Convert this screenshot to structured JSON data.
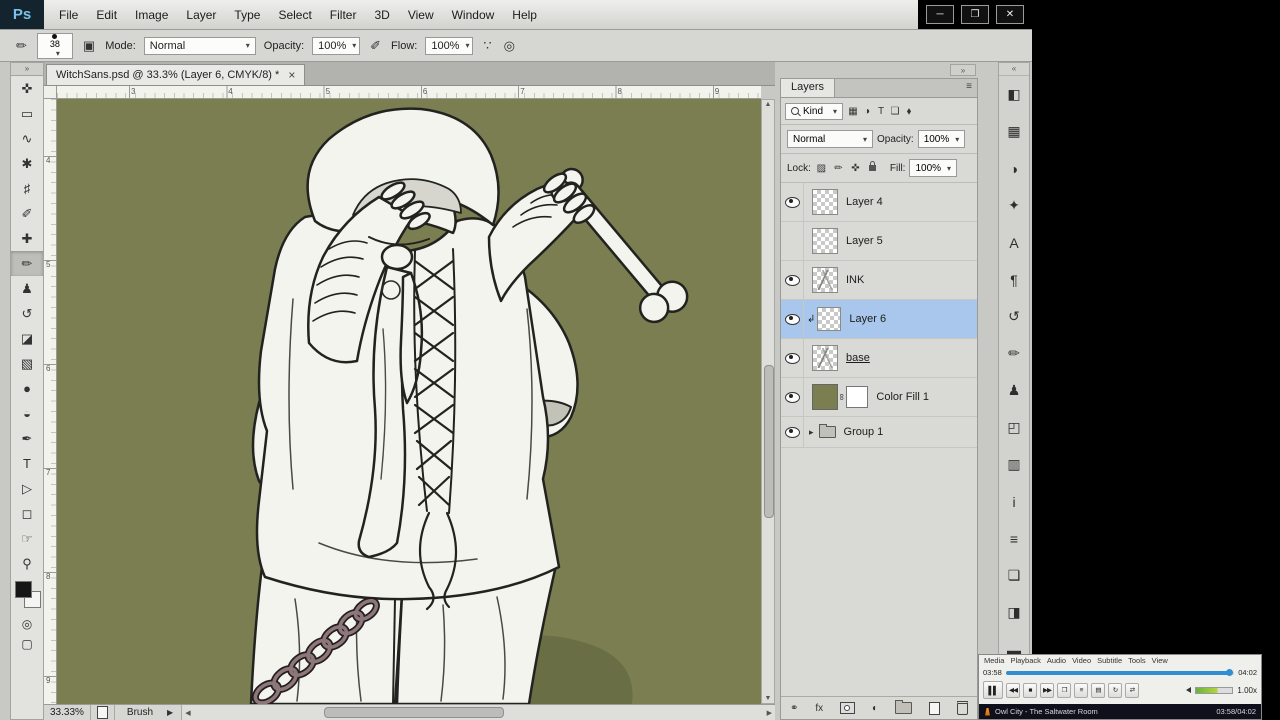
{
  "app": {
    "logo_text": "Ps",
    "menu_items": [
      "File",
      "Edit",
      "Image",
      "Layer",
      "Type",
      "Select",
      "Filter",
      "3D",
      "View",
      "Window",
      "Help"
    ],
    "window_buttons": {
      "minimize": "─",
      "maximize": "❐",
      "close": "✕"
    }
  },
  "options_bar": {
    "brush_size": "38",
    "mode_label": "Mode:",
    "mode_value": "Normal",
    "opacity_label": "Opacity:",
    "opacity_value": "100%",
    "flow_label": "Flow:",
    "flow_value": "100%"
  },
  "tools": [
    {
      "name": "move",
      "glyph": "✜"
    },
    {
      "name": "rectangular-marquee",
      "glyph": "▭"
    },
    {
      "name": "lasso",
      "glyph": "∿"
    },
    {
      "name": "magic-wand",
      "glyph": "✱"
    },
    {
      "name": "crop",
      "glyph": "♯"
    },
    {
      "name": "eyedropper",
      "glyph": "✐"
    },
    {
      "name": "spot-healing",
      "glyph": "✚"
    },
    {
      "name": "brush",
      "glyph": "✏",
      "selected": true
    },
    {
      "name": "clone-stamp",
      "glyph": "♟"
    },
    {
      "name": "history-brush",
      "glyph": "↺"
    },
    {
      "name": "eraser",
      "glyph": "◪"
    },
    {
      "name": "gradient",
      "glyph": "▧"
    },
    {
      "name": "blur",
      "glyph": "●"
    },
    {
      "name": "dodge",
      "glyph": "◒"
    },
    {
      "name": "pen",
      "glyph": "✒"
    },
    {
      "name": "type",
      "glyph": "T"
    },
    {
      "name": "path-selection",
      "glyph": "▷"
    },
    {
      "name": "shape",
      "glyph": "◻"
    },
    {
      "name": "hand",
      "glyph": "☞"
    },
    {
      "name": "zoom",
      "glyph": "⚲"
    }
  ],
  "document": {
    "tab_title": "WitchSans.psd @ 33.3% (Layer 6, CMYK/8) *",
    "tab_close": "×",
    "ruler_top": [
      "3",
      "4",
      "5",
      "6",
      "7",
      "8",
      "9"
    ],
    "ruler_left": [
      "4",
      "5",
      "6",
      "7",
      "8",
      "9"
    ],
    "status_zoom": "33.33%",
    "status_tool": "Brush"
  },
  "layers_panel": {
    "tab_label": "Layers",
    "panel_menu_glyph": "≡",
    "collapse_glyph": "»",
    "kind_label": "Kind",
    "blend_mode": "Normal",
    "opacity_label": "Opacity:",
    "opacity_value": "100%",
    "lock_label": "Lock:",
    "fill_label": "Fill:",
    "fill_value": "100%",
    "footer_fx": "fx",
    "filter_icons": [
      {
        "name": "filter-pixel-layers-icon",
        "glyph": "▦"
      },
      {
        "name": "filter-adjustment-layers-icon",
        "glyph": "◑"
      },
      {
        "name": "filter-type-layers-icon",
        "glyph": "T"
      },
      {
        "name": "filter-shape-layers-icon",
        "glyph": "❑"
      },
      {
        "name": "filter-smart-objects-icon",
        "glyph": "⬧"
      }
    ],
    "layers": [
      {
        "name": "Layer 4",
        "visible": true,
        "selected": false,
        "kind": "pixel"
      },
      {
        "name": "Layer 5",
        "visible": false,
        "selected": false,
        "kind": "pixel"
      },
      {
        "name": "INK",
        "visible": true,
        "selected": false,
        "kind": "art"
      },
      {
        "name": "Layer 6",
        "visible": true,
        "selected": true,
        "kind": "pixel",
        "clipped": true
      },
      {
        "name": "base",
        "visible": true,
        "selected": false,
        "kind": "art",
        "underline": true
      },
      {
        "name": "Color Fill 1",
        "visible": true,
        "selected": false,
        "kind": "fill"
      },
      {
        "name": "Group 1",
        "visible": true,
        "selected": false,
        "kind": "group"
      }
    ]
  },
  "right_panel_icons": [
    {
      "name": "color-panel-icon",
      "glyph": "◧"
    },
    {
      "name": "swatches-panel-icon",
      "glyph": "▦"
    },
    {
      "name": "adjustments-panel-icon",
      "glyph": "◑"
    },
    {
      "name": "styles-panel-icon",
      "glyph": "✦"
    },
    {
      "name": "character-panel-icon",
      "glyph": "A"
    },
    {
      "name": "paragraph-panel-icon",
      "glyph": "¶"
    },
    {
      "name": "history-panel-icon",
      "glyph": "↺"
    },
    {
      "name": "brush-presets-panel-icon",
      "glyph": "✏"
    },
    {
      "name": "clone-source-panel-icon",
      "glyph": "♟"
    },
    {
      "name": "navigator-panel-icon",
      "glyph": "◰"
    },
    {
      "name": "histogram-panel-icon",
      "glyph": "▥"
    },
    {
      "name": "info-panel-icon",
      "glyph": "i"
    },
    {
      "name": "properties-panel-icon",
      "glyph": "≡"
    },
    {
      "name": "layer-comps-panel-icon",
      "glyph": "❏"
    },
    {
      "name": "channels-panel-icon",
      "glyph": "◨"
    },
    {
      "name": "timeline-panel-icon",
      "glyph": "▬"
    },
    {
      "name": "notes-panel-icon",
      "glyph": "✎"
    }
  ],
  "media_player": {
    "menu_items": [
      "Media",
      "Playback",
      "Audio",
      "Video",
      "Subtitle",
      "Tools",
      "View"
    ],
    "elapsed": "03:58",
    "total": "04:02",
    "progress_pct": 98,
    "controls": [
      {
        "name": "pause-button",
        "glyph": "▌▌",
        "big": true
      },
      {
        "name": "previous-button",
        "glyph": "◀◀"
      },
      {
        "name": "stop-button",
        "glyph": "■"
      },
      {
        "name": "next-button",
        "glyph": "▶▶"
      },
      {
        "name": "fullscreen-button",
        "glyph": "❒"
      },
      {
        "name": "extended-settings-button",
        "glyph": "≡"
      },
      {
        "name": "playlist-button",
        "glyph": "▤"
      },
      {
        "name": "loop-button",
        "glyph": "↻"
      },
      {
        "name": "shuffle-button",
        "glyph": "⇄"
      }
    ],
    "rate": "1.00x",
    "title": "Owl City - The Saltwater Room",
    "time_display": "03:58/04:02"
  },
  "colors": {
    "canvas": "#7a7e51",
    "selection": "#a9c7ec",
    "seek": "#2f8fd0"
  }
}
